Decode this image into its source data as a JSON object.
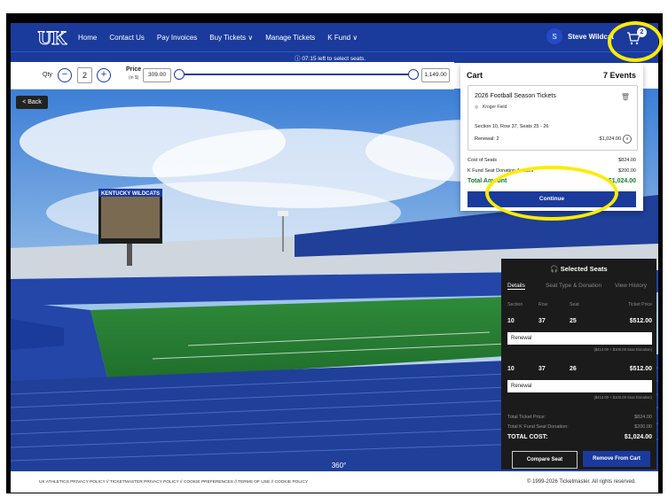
{
  "nav": {
    "links": [
      "Home",
      "Contact Us",
      "Pay Invoices",
      "Buy Tickets ∨",
      "Manage Tickets",
      "K Fund ∨"
    ],
    "user_initial": "S",
    "user_name": "Steve Wildcat",
    "cart_count": "2"
  },
  "timer": {
    "text": "07:15 left to select seats."
  },
  "filters": {
    "qty_label": "Qty",
    "qty_value": "2",
    "minus": "−",
    "plus": "+",
    "price_label": "Price",
    "price_unit": "(in $)",
    "price_min": "309.00",
    "price_max": "1,149.00"
  },
  "back_label": "< Back",
  "cart": {
    "title": "Cart",
    "events_count": "7 Events",
    "event_name": "2026 Football Season Tickets",
    "venue": "Kroger Field",
    "seats": "Section 10, Row 37, Seats 25 - 26",
    "renewal": "Renewal: 2",
    "renewal_amount": "$1,024.00",
    "cost_label": "Cost of Seats",
    "cost_value": "$824.00",
    "donation_label": "K Fund Seat Donation Amount",
    "donation_value": "$200.00",
    "total_label": "Total Amount",
    "total_value": "$1,024.00",
    "continue_label": "Continue"
  },
  "selected": {
    "title": "Selected Seats",
    "tabs": [
      "Details",
      "Seat Type & Donation",
      "View History"
    ],
    "cols": [
      "Section",
      "Row",
      "Seat",
      "Ticket Price"
    ],
    "rows": [
      {
        "section": "10",
        "row": "37",
        "seat": "25",
        "price": "$512.00",
        "type": "Renewal",
        "note": "($412.00 + $100.00 Seat Donation)"
      },
      {
        "section": "10",
        "row": "37",
        "seat": "26",
        "price": "$512.00",
        "type": "Renewal",
        "note": "($412.00 + $100.00 Seat Donation)"
      }
    ],
    "ticket_price_label": "Total Ticket Price:",
    "ticket_price_value": "$824.00",
    "kfund_label": "Total K Fund Seat Donation:",
    "kfund_value": "$200.00",
    "total_label": "TOTAL COST:",
    "total_value": "$1,024.00",
    "compare_label": "Compare Seat",
    "remove_label": "Remove From Cart"
  },
  "stadium": {
    "scoreboard": "KENTUCKY WILDCATS",
    "view_label": "360°"
  },
  "footer": {
    "links": "UK ATHLETICS PRIVACY POLICY  //  TICKETMASTER PRIVACY POLICY  //  COOKIE PREFERENCES  //  TERMS OF USE  //  COOKIE POLICY",
    "copyright": "© 1999-2026 Ticketmaster. All rights reserved."
  },
  "colors": {
    "brand": "#1a3a9c",
    "highlight": "#ffeb00",
    "total_green": "#1a7a2e"
  }
}
